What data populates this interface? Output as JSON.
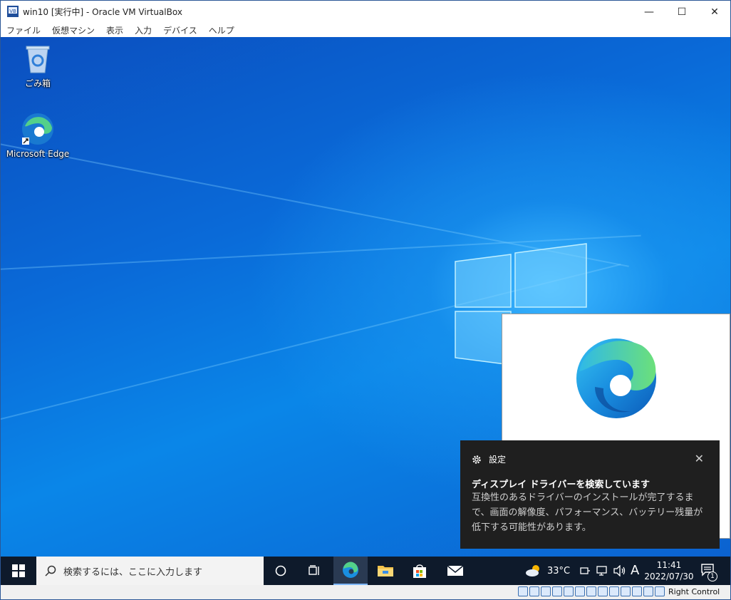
{
  "window": {
    "title": "win10 [実行中] - Oracle VM VirtualBox",
    "minimize_glyph": "—",
    "maximize_glyph": "☐",
    "close_glyph": "✕"
  },
  "menu": {
    "items": [
      "ファイル",
      "仮想マシン",
      "表示",
      "入力",
      "デバイス",
      "ヘルプ"
    ]
  },
  "desktop": {
    "icons": [
      {
        "label": "ごみ箱",
        "icon": "recycle-bin-icon"
      },
      {
        "label": "Microsoft Edge",
        "icon": "edge-icon"
      }
    ]
  },
  "toast": {
    "app_name": "設定",
    "title": "ディスプレイ ドライバーを検索しています",
    "body": "互換性のあるドライバーのインストールが完了するまで、画面の解像度、パフォーマンス、バッテリー残量が低下する可能性があります。",
    "close_glyph": "✕"
  },
  "taskbar": {
    "search_placeholder": "検索するには、ここに入力します",
    "weather_temp": "33°C",
    "ime_indicator": "A",
    "time": "11:41",
    "date": "2022/07/30",
    "notification_count": "1"
  },
  "statusbar": {
    "host_key": "Right Control"
  },
  "colors": {
    "accent": "#0a6ad8",
    "taskbar": "#0e1a2b",
    "toast_bg": "#1f1f1f"
  }
}
